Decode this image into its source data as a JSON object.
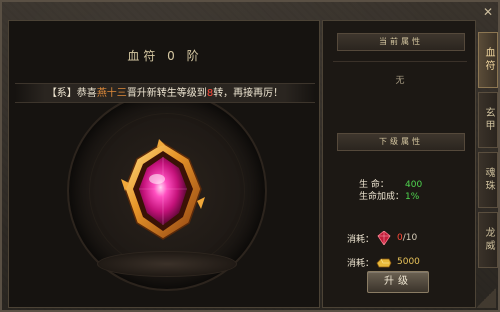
{
  "colors": {
    "accent_gold": "#e8c35a",
    "value_green": "#4fd54f",
    "warning_red": "#ff4a3a",
    "name_orange": "#e08b3a",
    "gem_magenta": "#ff2fa8"
  },
  "window": {
    "close_label": "✕"
  },
  "tabs": [
    {
      "label": "血符",
      "active": true
    },
    {
      "label": "玄甲",
      "active": false
    },
    {
      "label": "魂珠",
      "active": false
    },
    {
      "label": "龙威",
      "active": false
    }
  ],
  "left": {
    "title": "血符 0 阶",
    "notice": {
      "prefix": "【系】恭喜",
      "player": "燕十三",
      "middle": "晋升新转生等级到",
      "level": "8",
      "suffix": "转，再接再厉！"
    },
    "item_icon": "blood-rune-gem-icon"
  },
  "right": {
    "current_header": "当前属性",
    "current_value": "无",
    "next_header": "下级属性",
    "attributes": [
      {
        "label": "生    命：",
        "value": "400"
      },
      {
        "label": "生命加成：",
        "value": "1%"
      }
    ],
    "costs": [
      {
        "label": "消耗：",
        "icon": "red-crystal-icon",
        "have": "0",
        "need": "/10"
      },
      {
        "label": "消耗：",
        "icon": "gold-ingot-icon",
        "value": "5000"
      }
    ],
    "upgrade_button": "升级"
  }
}
